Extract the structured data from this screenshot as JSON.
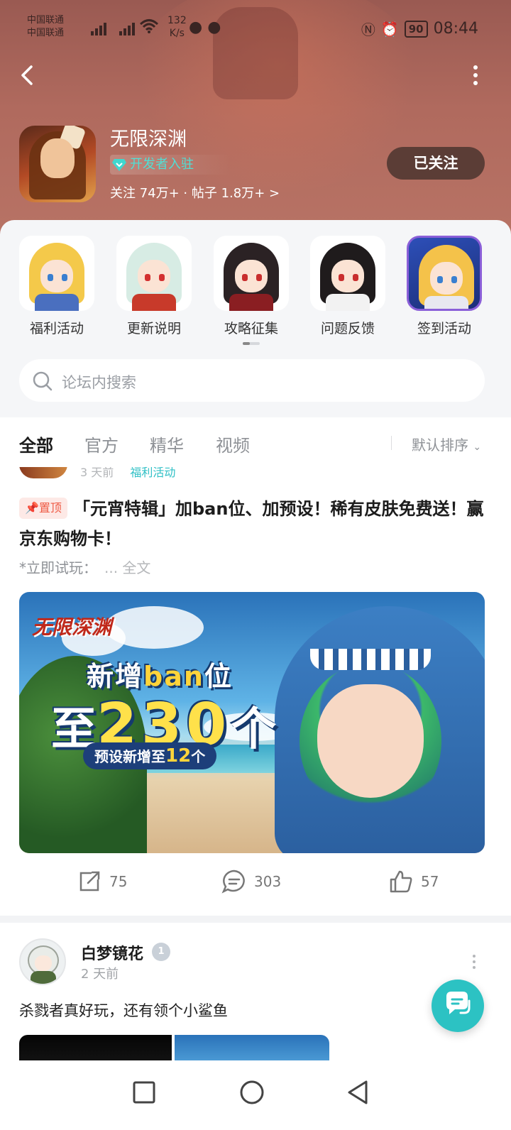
{
  "status_bar": {
    "carrier_1": "中国联通",
    "carrier_2": "中国联通",
    "net_speed_value": "132",
    "net_speed_unit": "K/s",
    "battery": "90",
    "time": "08:44"
  },
  "header": {
    "game_name": "无限深渊",
    "developer_badge": "开发者入驻",
    "stats": "关注 74万+ · 帖子 1.8万+ >",
    "follow_button": "已关注"
  },
  "shortcuts": [
    {
      "label": "福利活动"
    },
    {
      "label": "更新说明"
    },
    {
      "label": "攻略征集"
    },
    {
      "label": "问题反馈"
    },
    {
      "label": "签到活动"
    }
  ],
  "search": {
    "placeholder": "论坛内搜索"
  },
  "tabs": {
    "items": [
      "全部",
      "官方",
      "精华",
      "视频"
    ],
    "active_index": 0,
    "sort": "默认排序"
  },
  "feed": {
    "prev_post_meta": {
      "time": "3 天前",
      "tag": "福利活动"
    },
    "pinned_post": {
      "pin_label": "置顶",
      "title": "「元宵特辑」加ban位、加预设！稀有皮肤免费送！赢京东购物卡！",
      "excerpt": "*立即试玩：",
      "more": "... 全文",
      "banner": {
        "logo": "无限深渊",
        "line1_a": "新增",
        "line1_b": "ban",
        "line1_c": "位",
        "line2_a": "至",
        "line2_b": "230",
        "line2_c": "个",
        "line3_a": "预设新增至",
        "line3_b": "12",
        "line3_c": "个"
      },
      "shares": "75",
      "comments": "303",
      "likes": "57"
    },
    "post_2": {
      "author": "白梦镜花",
      "level": "1",
      "time": "2 天前",
      "text": "杀戮者真好玩，还有领个小鲨鱼"
    }
  },
  "colors": {
    "accent": "#2cc2c3",
    "header_bg": "#b06a5e",
    "pin": "#ee5a44"
  }
}
